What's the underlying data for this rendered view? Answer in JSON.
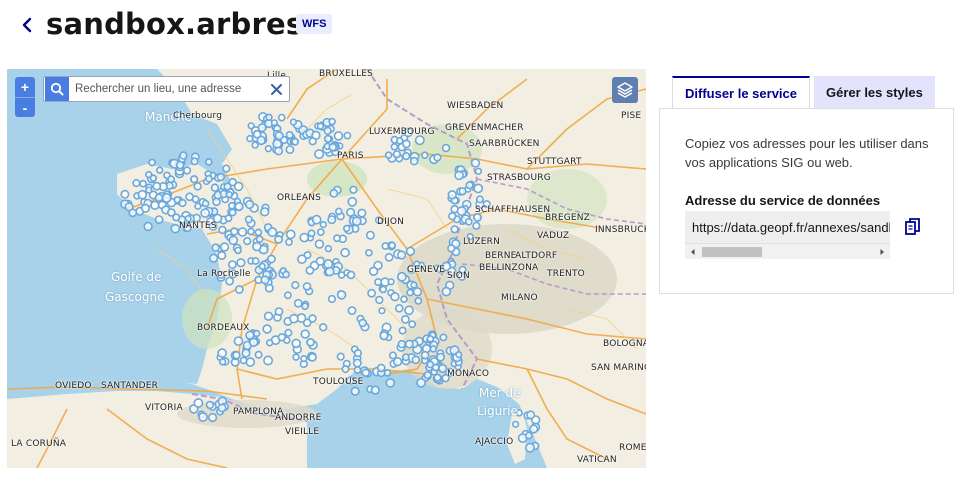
{
  "header": {
    "title": "sandbox.arbres",
    "badge": "WFS"
  },
  "map": {
    "search_placeholder": "Rechercher un lieu, une adresse",
    "zoom_in": "+",
    "zoom_out": "-",
    "point_color": "#6aa8dc",
    "seas": [
      {
        "key": "manche",
        "label": "Manche"
      },
      {
        "key": "gascogne_1",
        "label": "Golfe de"
      },
      {
        "key": "gascogne_2",
        "label": "Gascogne"
      },
      {
        "key": "ligurie_1",
        "label": "Mer de"
      },
      {
        "key": "ligurie_2",
        "label": "Ligurie"
      }
    ],
    "cities": [
      "BRUXELLES",
      "WIESBADEN",
      "LUXEMBOURG",
      "GREVENMACHER",
      "SAARBRÜCKEN",
      "STUTTGART",
      "STRASBOURG",
      "SCHAFFHAUSEN",
      "BREGENZ",
      "VADUZ",
      "INNSBRUCK",
      "BERNE",
      "LUZERN",
      "ALTDORF",
      "BELLINZONA",
      "TRENTO",
      "SION",
      "MILANO",
      "GENEVE",
      "DIJON",
      "ORLEANS",
      "PARIS",
      "NANTES",
      "La Rochelle",
      "BORDEAUX",
      "TOULOUSE",
      "ANDORRE",
      "PAMPLONA",
      "VITORIA",
      "OVIEDO",
      "SANTANDER",
      "LA CORUÑA",
      "VIEILLE",
      "AJACCIO",
      "ROME",
      "VATICAN",
      "SAN MARINO",
      "BOLOGNA",
      "Cherbourg",
      "Lille",
      "PISE",
      "MONACO"
    ]
  },
  "tabs": [
    {
      "label": "Diffuser le service",
      "active": true
    },
    {
      "label": "Gérer les styles",
      "active": false
    }
  ],
  "panel": {
    "description": "Copiez vos adresses pour les utiliser dans vos applications SIG ou web.",
    "field_label": "Adresse du service de données",
    "url": "https://data.geopf.fr/annexes/sandbox"
  },
  "colors": {
    "accent": "#000091",
    "tab_inactive_bg": "#e3e3fd",
    "map_control": "#4a7de2"
  }
}
